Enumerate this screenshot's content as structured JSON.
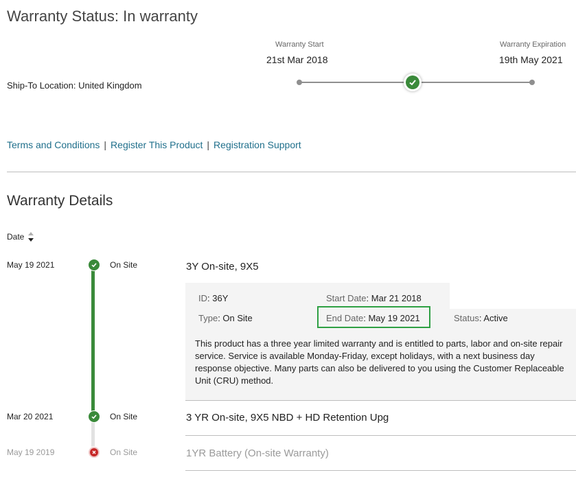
{
  "header": {
    "title": "Warranty Status: In warranty",
    "ship_to_label": "Ship-To Location: United Kingdom",
    "warranty_start_label": "Warranty Start",
    "warranty_start_date": "21st Mar 2018",
    "warranty_expiration_label": "Warranty Expiration",
    "warranty_expiration_date": "19th May 2021"
  },
  "links": {
    "terms": "Terms and Conditions",
    "register": "Register This Product",
    "support": "Registration Support",
    "separator": "|"
  },
  "details": {
    "title": "Warranty Details",
    "sort_label": "Date",
    "rows": [
      {
        "date": "May 19 2021",
        "type": "On Site",
        "title": "3Y On-site, 9X5",
        "status_icon": "check-icon",
        "expanded": true,
        "id_label": "ID",
        "id_value": "36Y",
        "start_label": "Start Date",
        "start_value": "Mar 21 2018",
        "type_label": "Type",
        "type_value": "On Site",
        "end_label": "End Date",
        "end_value": "May 19 2021",
        "status_label": "Status",
        "status_value": "Active",
        "description": "This product has a three year limited warranty and is entitled to parts, labor and on-site repair service. Service is available Monday-Friday, except holidays, with a next business day response objective. Many parts can also be delivered to you using the Customer Replaceable Unit (CRU) method."
      },
      {
        "date": "Mar 20 2021",
        "type": "On Site",
        "title": "3 YR On-site, 9X5 NBD + HD Retention Upg",
        "status_icon": "check-icon"
      },
      {
        "date": "May 19 2019",
        "type": "On Site",
        "title": "1YR Battery (On-site Warranty)",
        "status_icon": "x-icon"
      }
    ]
  },
  "colors": {
    "green": "#3a8a3a",
    "red": "#c62828",
    "link": "#1f6f8b",
    "highlight_border": "#2ea043"
  }
}
